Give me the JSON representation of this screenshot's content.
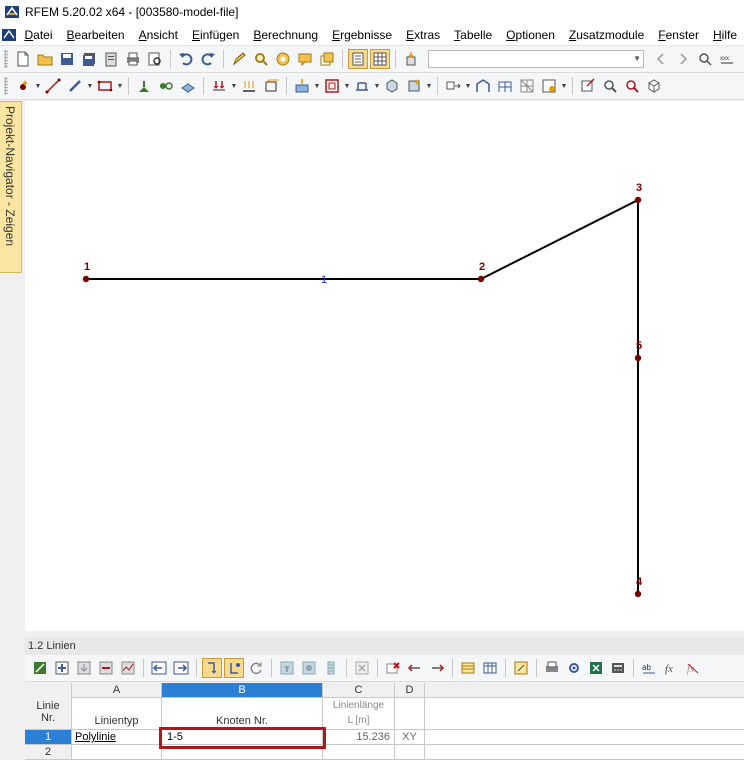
{
  "window": {
    "title": "RFEM 5.20.02 x64 - [003580-model-file]"
  },
  "menu": {
    "items": [
      "Datei",
      "Bearbeiten",
      "Ansicht",
      "Einfügen",
      "Berechnung",
      "Ergebnisse",
      "Extras",
      "Tabelle",
      "Optionen",
      "Zusatzmodule",
      "Fenster",
      "Hilfe"
    ]
  },
  "toolbar1": {
    "combo_value": ""
  },
  "navigator": {
    "tab_label": "Projekt-Navigator - Zeigen"
  },
  "model": {
    "nodes": [
      {
        "id": "1",
        "label": "1"
      },
      {
        "id": "2",
        "label": "2"
      },
      {
        "id": "3",
        "label": "3"
      },
      {
        "id": "4",
        "label": "4"
      },
      {
        "id": "5",
        "label": "5"
      }
    ],
    "line_label": "1",
    "colors": {
      "node": "#7a0000",
      "line": "#000000",
      "line_label": "#1a2dd6",
      "node_label": "#7a0000"
    }
  },
  "panel": {
    "title": "1.2 Linien",
    "columns": {
      "row_header_line1": "Linie",
      "row_header_line2": "Nr.",
      "A_letter": "A",
      "A_label": "Linientyp",
      "B_letter": "B",
      "B_label": "Knoten Nr.",
      "C_letter": "C",
      "C_label1": "Linienlänge",
      "C_label2": "L [m]",
      "D_letter": "D"
    },
    "rows": [
      {
        "nr": "1",
        "type": "Polylinie",
        "nodes": "1-5",
        "length": "15.236",
        "d": "XY"
      },
      {
        "nr": "2",
        "type": "",
        "nodes": "",
        "length": "",
        "d": ""
      }
    ],
    "accent": "#2b7fd4",
    "highlight": "#b0171b"
  }
}
